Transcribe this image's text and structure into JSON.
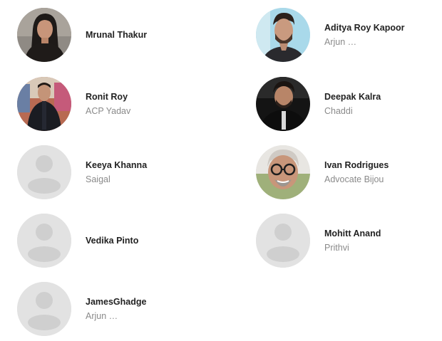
{
  "cast": [
    {
      "name": "Mrunal Thakur",
      "role": "",
      "photo": "portrait-woman-dark-hair"
    },
    {
      "name": "Aditya Roy Kapoor",
      "role": "Arjun …",
      "photo": "portrait-man-beard"
    },
    {
      "name": "Ronit Roy",
      "role": "ACP Yadav",
      "photo": "portrait-man-suit"
    },
    {
      "name": "Deepak Kalra",
      "role": "Chaddi",
      "photo": "portrait-man-black-shirt"
    },
    {
      "name": "Keeya Khanna",
      "role": "Saigal",
      "photo": "placeholder-person"
    },
    {
      "name": "Ivan Rodrigues",
      "role": "Advocate Bijou",
      "photo": "portrait-man-glasses"
    },
    {
      "name": "Vedika Pinto",
      "role": "",
      "photo": "placeholder-person"
    },
    {
      "name": "Mohitt Anand",
      "role": "Prithvi",
      "photo": "placeholder-person"
    },
    {
      "name": "JamesGhadge",
      "role": "Arjun …",
      "photo": "placeholder-person"
    }
  ],
  "colors": {
    "placeholder_bg": "#e2e2e2",
    "placeholder_fg": "#cfcfcf",
    "name_text": "#222222",
    "role_text": "#8a8a8a"
  }
}
